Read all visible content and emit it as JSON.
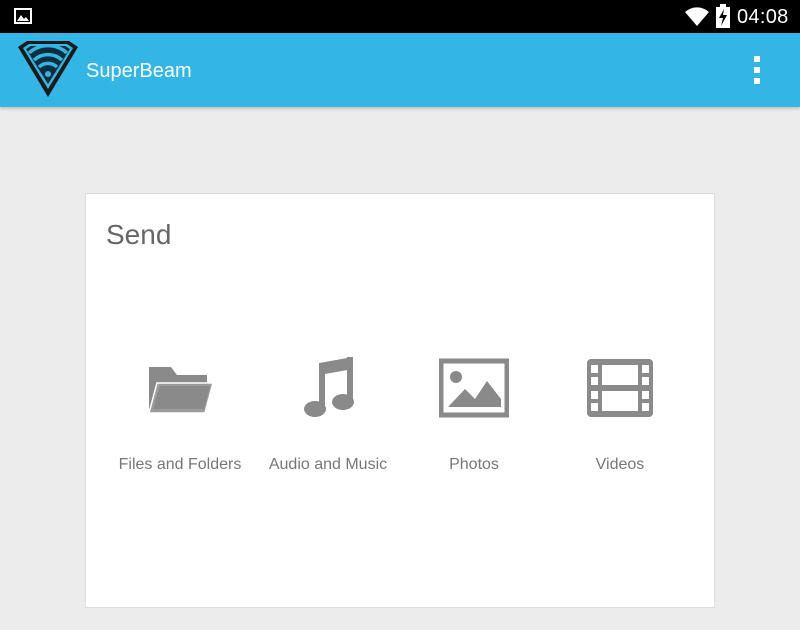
{
  "status_bar": {
    "time": "04:08",
    "icons": [
      "image-notification-icon",
      "wifi-icon",
      "battery-charging-icon"
    ]
  },
  "action_bar": {
    "title": "SuperBeam",
    "logo": "superbeam-logo",
    "menu_icon": "overflow-menu-icon",
    "color": "#33b5e5"
  },
  "send_card": {
    "title": "Send",
    "options": [
      {
        "label": "Files and Folders",
        "icon": "folder-icon"
      },
      {
        "label": "Audio and Music",
        "icon": "music-note-icon"
      },
      {
        "label": "Photos",
        "icon": "photo-icon"
      },
      {
        "label": "Videos",
        "icon": "film-icon"
      }
    ]
  },
  "colors": {
    "background": "#ececec",
    "icon": "#8a8a8a",
    "label": "#777777"
  }
}
